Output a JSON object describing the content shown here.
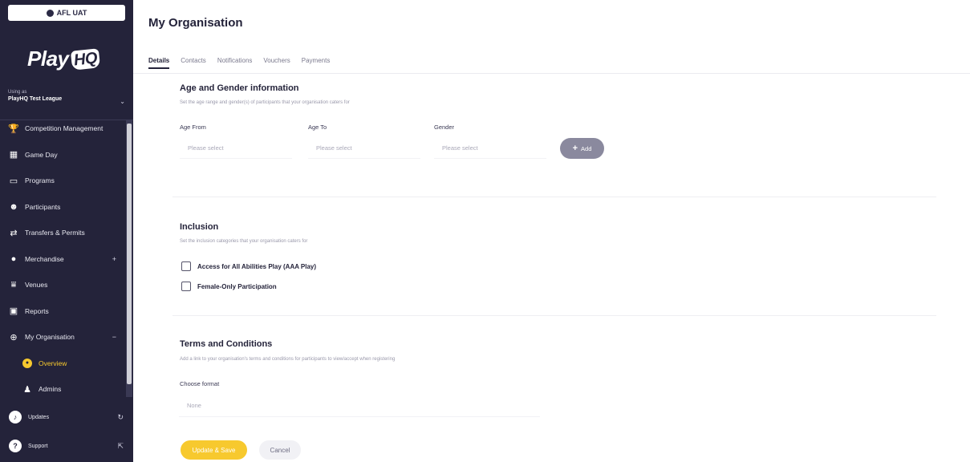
{
  "env_badge": "AFL UAT",
  "logo": {
    "play": "Play",
    "hq": "HQ"
  },
  "using_as": {
    "label": "Using as",
    "org": "PlayHQ Test League"
  },
  "sidebar": {
    "items": [
      {
        "label": "Competition Management",
        "icon": "trophy-icon"
      },
      {
        "label": "Game Day",
        "icon": "scoreboard-icon"
      },
      {
        "label": "Programs",
        "icon": "book-icon"
      },
      {
        "label": "Participants",
        "icon": "people-icon"
      },
      {
        "label": "Transfers & Permits",
        "icon": "transfer-icon"
      },
      {
        "label": "Merchandise",
        "icon": "shirt-icon",
        "extra": "+"
      },
      {
        "label": "Venues",
        "icon": "stadium-icon"
      },
      {
        "label": "Reports",
        "icon": "chart-icon"
      },
      {
        "label": "My Organisation",
        "icon": "globe-icon",
        "extra": "−"
      }
    ],
    "subitems": [
      {
        "label": "Overview",
        "icon": "overview-icon"
      },
      {
        "label": "Admins",
        "icon": "admin-icon"
      }
    ],
    "bottom": [
      {
        "label": "Updates",
        "icon": "bell-icon"
      },
      {
        "label": "Support",
        "icon": "question-icon"
      }
    ]
  },
  "header": {
    "title": "My Organisation"
  },
  "tabs": [
    {
      "label": "Details"
    },
    {
      "label": "Contacts"
    },
    {
      "label": "Notifications"
    },
    {
      "label": "Vouchers"
    },
    {
      "label": "Payments"
    }
  ],
  "age_gender": {
    "title": "Age and Gender information",
    "desc": "Set the age range and gender(s) of participants that your organisation caters for",
    "age_from_label": "Age From",
    "age_to_label": "Age To",
    "gender_label": "Gender",
    "placeholder": "Please select",
    "add_label": "Add"
  },
  "inclusion": {
    "title": "Inclusion",
    "desc": "Set the inclusion categories that your organisation caters for",
    "options": [
      "Access for All Abilities Play (AAA Play)",
      "Female-Only Participation"
    ]
  },
  "terms": {
    "title": "Terms and Conditions",
    "desc": "Add a link to your organisation's terms and conditions for participants to view/accept when registering",
    "format_label": "Choose format",
    "format_value": "None"
  },
  "actions": {
    "save": "Update & Save",
    "cancel": "Cancel"
  },
  "colors": {
    "sidebar": "#24233a",
    "accent": "#f7c92e"
  }
}
